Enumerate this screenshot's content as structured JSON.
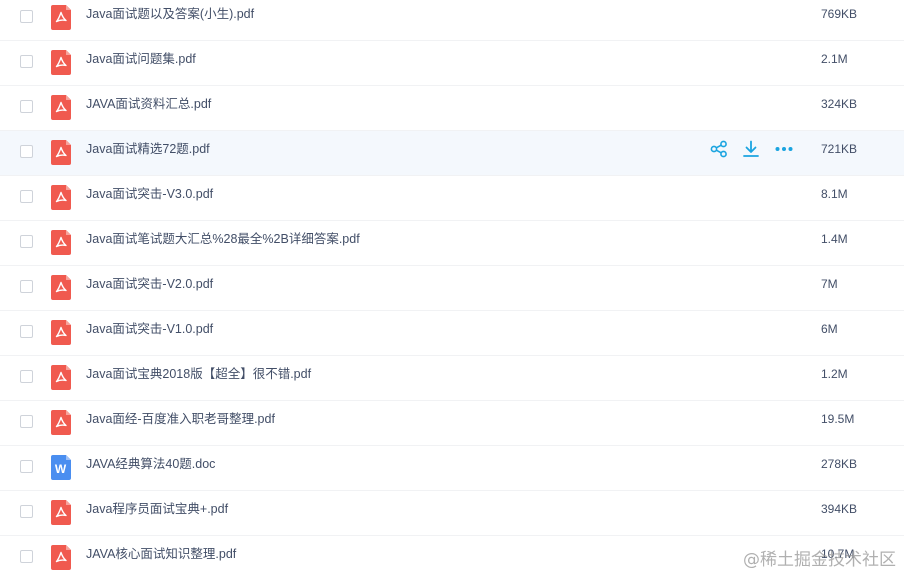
{
  "files": [
    {
      "name": "Java面试题以及答案(小生).pdf",
      "size": "769KB",
      "type": "pdf",
      "icon": "pdf-file-icon"
    },
    {
      "name": "Java面试问题集.pdf",
      "size": "2.1M",
      "type": "pdf",
      "icon": "pdf-file-icon"
    },
    {
      "name": "JAVA面试资料汇总.pdf",
      "size": "324KB",
      "type": "pdf",
      "icon": "pdf-file-icon"
    },
    {
      "name": "Java面试精选72题.pdf",
      "size": "721KB",
      "type": "pdf",
      "icon": "pdf-file-icon",
      "hovered": true
    },
    {
      "name": "Java面试突击-V3.0.pdf",
      "size": "8.1M",
      "type": "pdf",
      "icon": "pdf-file-icon"
    },
    {
      "name": "Java面试笔试题大汇总%28最全%2B详细答案.pdf",
      "size": "1.4M",
      "type": "pdf",
      "icon": "pdf-file-icon"
    },
    {
      "name": "Java面试突击-V2.0.pdf",
      "size": "7M",
      "type": "pdf",
      "icon": "pdf-file-icon"
    },
    {
      "name": "Java面试突击-V1.0.pdf",
      "size": "6M",
      "type": "pdf",
      "icon": "pdf-file-icon"
    },
    {
      "name": "Java面试宝典2018版【超全】很不错.pdf",
      "size": "1.2M",
      "type": "pdf",
      "icon": "pdf-file-icon"
    },
    {
      "name": "Java面经-百度准入职老哥整理.pdf",
      "size": "19.5M",
      "type": "pdf",
      "icon": "pdf-file-icon"
    },
    {
      "name": "JAVA经典算法40题.doc",
      "size": "278KB",
      "type": "doc",
      "icon": "word-file-icon"
    },
    {
      "name": "Java程序员面试宝典+.pdf",
      "size": "394KB",
      "type": "pdf",
      "icon": "pdf-file-icon"
    },
    {
      "name": "JAVA核心面试知识整理.pdf",
      "size": "10.7M",
      "type": "pdf",
      "icon": "pdf-file-icon"
    }
  ],
  "row_actions": [
    {
      "name": "share",
      "icon": "share-icon"
    },
    {
      "name": "download",
      "icon": "download-icon"
    },
    {
      "name": "more",
      "icon": "more-icon"
    }
  ],
  "word_icon_letter": "W",
  "watermark": "@稀土掘金技术社区",
  "colors": {
    "pdf_icon": "#f05a4f",
    "word_icon": "#4a8ef0",
    "action": "#1aa4e0",
    "text": "#424e67",
    "hover_row": "#f4f8fd"
  }
}
